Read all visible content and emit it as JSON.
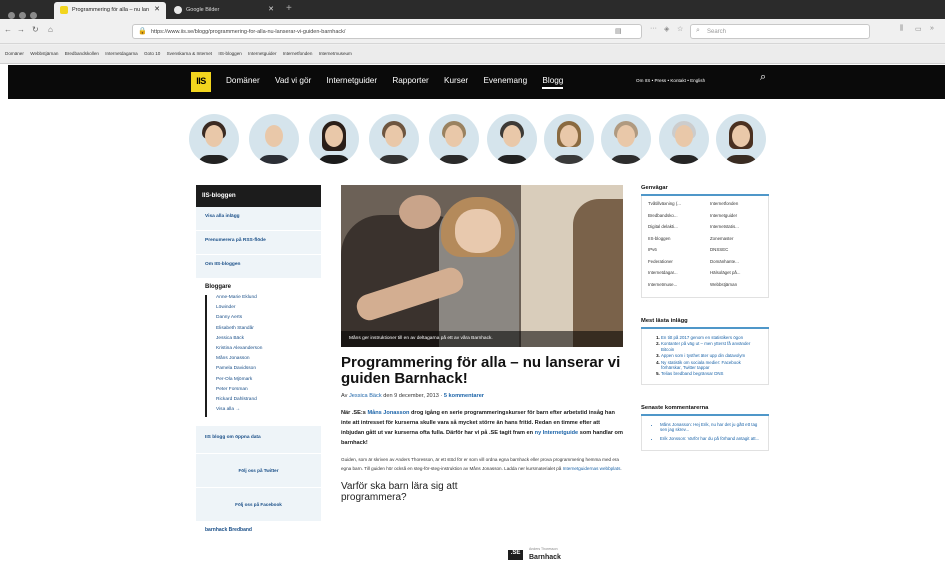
{
  "browser": {
    "tabs": [
      {
        "label": "Programmering för alla – nu lan"
      },
      {
        "label": "Google Bilder"
      }
    ],
    "url": "https://www.iis.se/blogg/programmering-for-alla-nu-lanserar-vi-guiden-barnhack/",
    "url_host_bold": "iis.se",
    "search_placeholder": "Search",
    "bookmarks": [
      "Domäner",
      "Webbstjärnan",
      "Bredbandskollen",
      "Internetdagarna",
      "Goto 10",
      "Svenskarna & Internet",
      "IIS-bloggen",
      "Internetguider",
      "Internetfonden",
      "Internetmuseum"
    ]
  },
  "site": {
    "logo": "IIS",
    "nav": [
      "Domäner",
      "Vad vi gör",
      "Internetguider",
      "Rapporter",
      "Kurser",
      "Evenemang",
      "Blogg"
    ],
    "nav_selected": "Blogg",
    "subnav": "Om IIS • Press • Kontakt • English"
  },
  "sidebar": {
    "title": "IIS-bloggen",
    "links": [
      "Visa alla inlägg",
      "Prenumerera på RSS-flöde",
      "Om IIS-bloggen"
    ],
    "bloggers_title": "Bloggare",
    "bloggers": [
      "Anne-Marie Eklund",
      "Löwinder",
      "Danny Aerts",
      "Elisabeth Standår",
      "Jessica Bäck",
      "Kristina Alexanderson",
      "Måns Jonasson",
      "Pamela Davidsson",
      "Per-Ola Mjömark",
      "Peter Forsman",
      "Rickard Dahlstrand",
      "Visa alla →"
    ],
    "open_data": "IIS blogg om öppna data",
    "twitter": "Följ oss på Twitter",
    "facebook": "Följ oss på Facebook",
    "tag": "barnhack Bredband"
  },
  "article": {
    "caption": "Måns ger instruktioner till en av deltagarna på ett av våra Barnhack.",
    "title": "Programmering för alla – nu lanserar vi guiden Barnhack!",
    "meta_prefix": "Av",
    "author": "Jessica Bäck",
    "meta_date": "den 9 december, 2013 ·",
    "comments": "5 kommentarer",
    "lead_a": "När .SE:s",
    "lead_link1": "Måns Jonasson",
    "lead_b": "drog igång en serie programmeringskurser för barn efter arbetstid insåg han inte att intresset för kurserna skulle vara så mycket större än hans fritid. Redan en timme efter att inbjudan gått ut var kurserna ofta fulla. Därför har vi på .SE tagit fram en",
    "lead_link2": "ny Internetguide",
    "lead_c": "som handlar om barnhack!",
    "body_a": "Guiden, som är skriven av Anders Thoresson, är ett stöd för er som vill ordna egna barnhack eller prova programmering hemma med era egna barn. Till guiden hör också en steg-för-steg-instruktion av Måns Jonasson. Ladda ner kursmaterialet på",
    "body_link": "Internetguidernas webbplats",
    "body_b": ".",
    "subheading": "Varför ska barn lära sig att programmera?",
    "book_logo": ".SE",
    "book_small": "Anders Thoresson",
    "book_title": "Barnhack"
  },
  "right": {
    "genvagar_title": "Genvägar",
    "genvagar": [
      "Tvåtillväxning (...",
      "Internetfonden",
      "Bredbandsko...",
      "Internetguider",
      "Digital delakti...",
      "Internetstatis...",
      "IIS-bloggen",
      "Zonemaster",
      "IPv6",
      "DNSSEC",
      "Federationer",
      "Domänhante...",
      "Internetdagar...",
      "Hälsoläget på...",
      "Internetmuse...",
      "Webbstjärnan"
    ],
    "mest_title": "Mest lästa inlägg",
    "mest": [
      "En titt på 2017 genom en statistikers ögon",
      "Kontanter på väg ut – men ytterst få använder Bitcoin",
      "Appen som i tysthet äter upp din datavolym",
      "Ny statistik om sociala medier: Facebook förhärskar, Twitter tappar",
      "Telias bredband begränsar DNS"
    ],
    "senaste_title": "Senaste kommentarerna",
    "senaste": [
      "Måns Jonasson: Hej Erik, nu har det ju gått ett tag sen jag skrev...",
      "Erik Jonsson: Varför har du på förhand antagit att..."
    ]
  }
}
